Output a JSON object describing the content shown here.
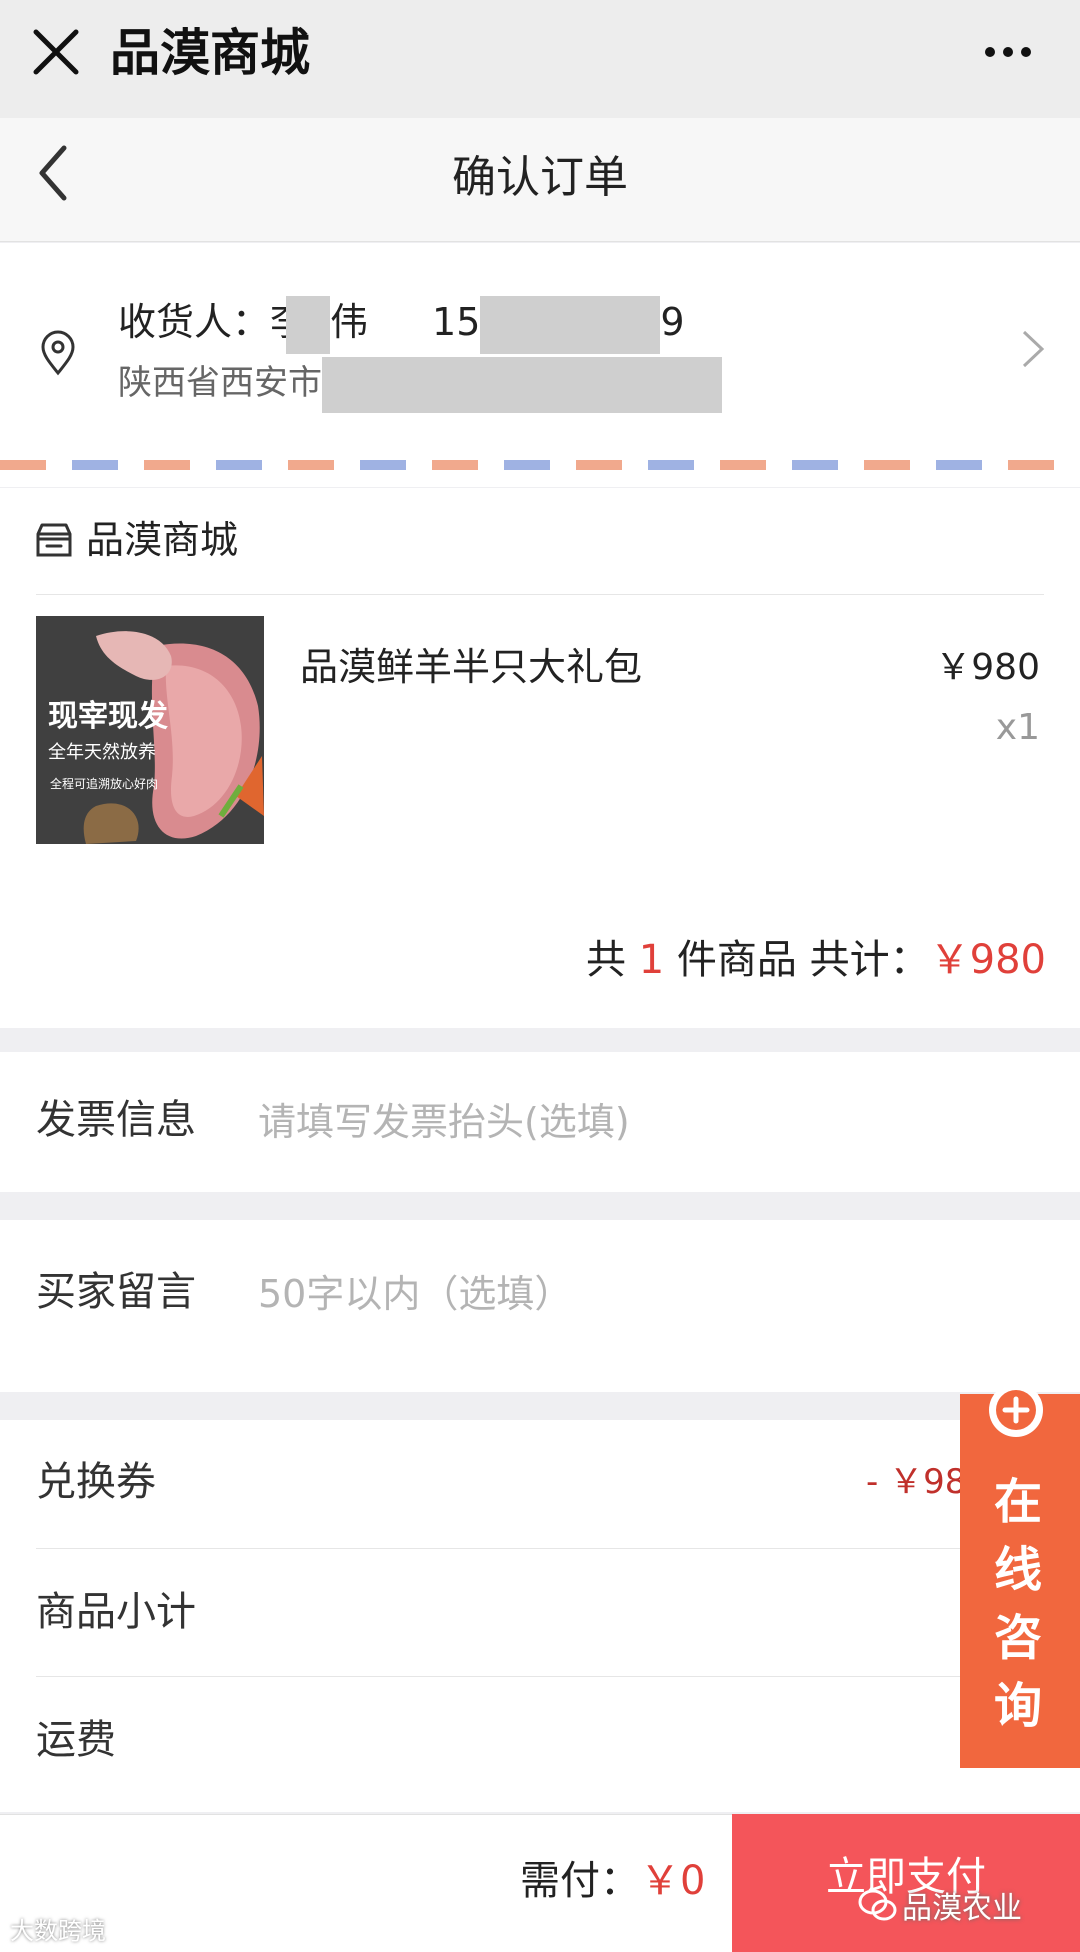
{
  "wechat": {
    "title": "品漠商城"
  },
  "nav": {
    "title": "确认订单"
  },
  "address": {
    "receiver_label": "收货人：",
    "name_first": "李",
    "name_last": "伟",
    "phone_prefix": "15",
    "phone_suffix": "9",
    "city": "陕西省西安市"
  },
  "shop": {
    "name": "品漠商城"
  },
  "product": {
    "name": "品漠鲜羊半只大礼包",
    "price": "￥980",
    "quantity": "x1",
    "image_text": {
      "headline": "现宰现发",
      "line2": "全年天然放养",
      "line3": "全程可追溯放心好肉"
    }
  },
  "summary": {
    "prefix": "共",
    "count": "1",
    "middle": "件商品 共计：",
    "total": "￥980"
  },
  "invoice": {
    "label": "发票信息",
    "placeholder": "请填写发票抬头(选填)"
  },
  "message": {
    "label": "买家留言",
    "placeholder": "50字以内（选填）"
  },
  "coupon": {
    "label": "兑换券",
    "value": "- ￥98"
  },
  "subtotal": {
    "label": "商品小计"
  },
  "shipping": {
    "label": "运费"
  },
  "bottom": {
    "need_pay_label": "需付：",
    "need_pay_value": "￥0",
    "pay_button": "立即支付"
  },
  "consult": {
    "chars": [
      "在",
      "线",
      "咨",
      "询"
    ]
  },
  "watermarks": {
    "left": "大数跨境",
    "right": "品漠农业"
  },
  "colors": {
    "accent_red": "#e0403a",
    "pay_button": "#f4555a",
    "consult_orange": "#f1673e"
  }
}
